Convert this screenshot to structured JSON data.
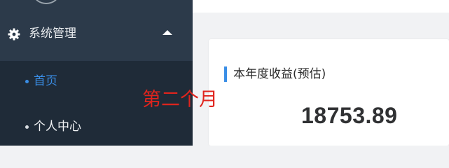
{
  "sidebar": {
    "group": {
      "label": "系统管理",
      "icon": "gear-icon",
      "expanded_icon": "caret-up-icon"
    },
    "items": [
      {
        "label": "首页",
        "active": true
      },
      {
        "label": "个人中心",
        "active": false
      }
    ]
  },
  "card": {
    "title": "本年度收益(预估)",
    "value": "18753.89"
  },
  "annotation": {
    "text": "第二个月"
  },
  "colors": {
    "sidebar_bg": "#2c3a4a",
    "submenu_bg": "#1f2b38",
    "accent": "#3a8ee6",
    "annotation": "#e0241d"
  }
}
